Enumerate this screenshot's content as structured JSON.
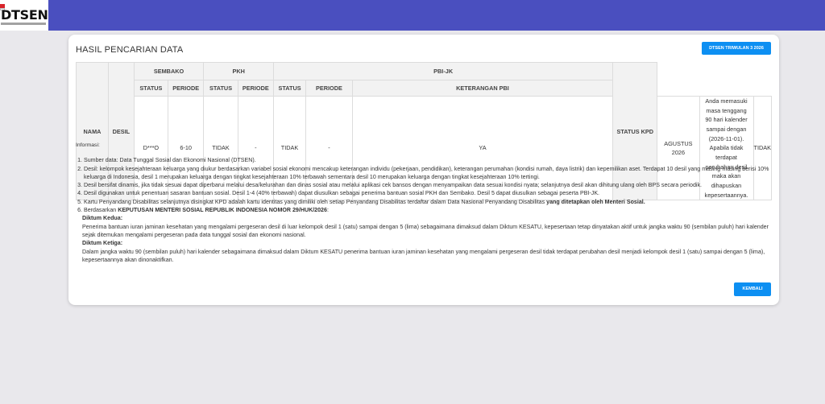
{
  "header": {
    "logo_text": "DTSEN"
  },
  "card": {
    "title": "HASIL PENCARIAN DATA",
    "triwulan_button": "DTSEN TRIWULAN 3 2026",
    "back_button": "KEMBALI"
  },
  "table": {
    "col_nama": "NAMA",
    "col_desil": "DESIL",
    "group_sembako": "SEMBAKO",
    "group_pkh": "PKH",
    "group_pbijk": "PBI-JK",
    "col_status_kpd": "STATUS KPD",
    "sub_status": "STATUS",
    "sub_periode": "PERIODE",
    "sub_keterangan": "KETERANGAN PBI",
    "row": {
      "nama": "D***O",
      "desil": "6-10",
      "sembako_status": "TIDAK",
      "sembako_periode": "-",
      "pkh_status": "TIDAK",
      "pkh_periode": "-",
      "pbi_status": "YA",
      "pbi_periode": "AGUSTUS 2026",
      "pbi_keterangan": "Anda memasuki masa tenggang 90 hari kalender sampai dengan (2026-11-01). Apabila tidak terdapat perubahan desil maka akan dihapuskan kepesertaannya.",
      "status_kpd": "TIDAK"
    }
  },
  "info": {
    "title": "Informasi:",
    "item1": "Sumber data: Data Tunggal Sosial dan Ekonomi Nasional (DTSEN).",
    "item2": "Desil: kelompok kesejahteraan keluarga yang diukur berdasarkan variabel sosial ekonomi mencakup keterangan individu (pekerjaan, pendidikan), keterangan perumahan (kondisi rumah, daya listrik) dan kepemilikan aset. Terdapat 10 desil yang masing-masing berisi 10% keluarga di Indonesia, desil 1 merupakan keluarga dengan tingkat kesejahteraan 10% terbawah sementara desil 10 merupakan keluarga dengan tingkat kesejahteraan 10% tertingi.",
    "item3": "Desil bersifat dinamis, jika tidak sesuai dapat diperbarui melalui desa/kelurahan dan dinas sosial atau melalui aplikasi cek bansos dengan menyampaikan data sesuai kondisi nyata; selanjutnya desil akan dihitung ulang oleh BPS secara periodik.",
    "item4": "Desil digunakan untuk penentuan sasaran bantuan sosial. Desil 1-4 (40% terbawah) dapat diusulkan sebagai penerima bantuan sosial PKH dan Sembako. Desil 5 dapat diusulkan sebagai peserta PBI-JK.",
    "item5_a": "Kartu Penyandang Disabilitas selanjutnya disingkat KPD adalah kartu identitas yang dimiliki oleh setiap Penyandang Disabilitas terdaftar dalam Data Nasional Penyandang Disabilitas ",
    "item5_b": "yang ditetapkan oleh Menteri Sosial.",
    "item6_a": "Berdasarkan ",
    "item6_b": "KEPUTUSAN MENTERI SOSIAL REPUBLIK INDONESIA NOMOR 29/HUK/2026",
    "item6_c": ":",
    "diktum_kedua_title": "Diktum Kedua:",
    "diktum_kedua_text": "Penerima bantuan iuran jaminan kesehatan yang mengalami pergeseran desil di luar kelompok desil 1 (satu) sampai dengan 5 (lima) sebagaimana dimaksud dalam Diktum KESATU, kepesertaan tetap dinyatakan aktif untuk jangka waktu 90 (sembilan puluh) hari kalender sejak ditemukan mengalami pergeseran pada data tunggal sosial dan ekonomi nasional.",
    "diktum_ketiga_title": "Diktum Ketiga:",
    "diktum_ketiga_text": "Dalam jangka waktu 90 (sembilan puluh) hari kalender sebagaimana dimaksud dalam Diktum KESATU penerima bantuan iuran jaminan kesehatan yang mengalami pergeseran desil tidak terdapat perubahan desil menjadi kelompok desil 1 (satu) sampai dengan 5 (lima), kepesertaannya akan dinonaktifkan."
  },
  "colors": {
    "topbar": "#4a4fbf",
    "primary_button": "#0d8ff2",
    "background": "#e9e8ec"
  }
}
